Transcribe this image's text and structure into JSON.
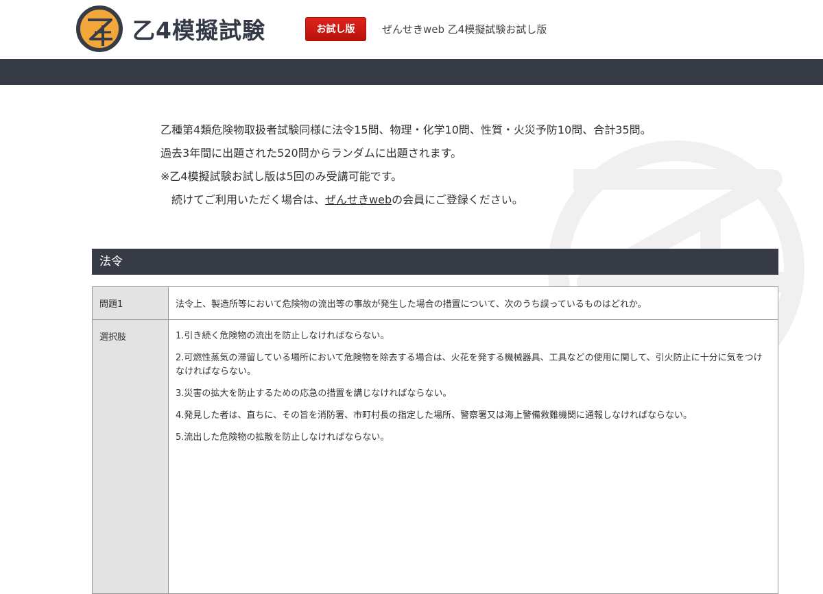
{
  "header": {
    "logo_text": "乙4模擬試験",
    "trial_badge": "お試し版",
    "tagline": "ぜんせきweb 乙4模擬試験お試し版"
  },
  "intro": {
    "line1": "乙種第4類危険物取扱者試験同様に法令15問、物理・化学10問、性質・火災予防10問、合計35問。",
    "line2": "過去3年間に出題された520問からランダムに出題されます。",
    "line3": "※乙4模擬試験お試し版は5回のみ受講可能です。",
    "line4_before": "続けてご利用いただく場合は、",
    "line4_link": "ぜんせきweb",
    "line4_after": "の会員にご登録ください。"
  },
  "section": {
    "title": "法令",
    "question_label": "問題1",
    "question_text": "法令上、製造所等において危険物の流出等の事故が発生した場合の措置について、次のうち誤っているものはどれか。",
    "choices_label": "選択肢",
    "choices": [
      "1.引き続く危険物の流出を防止しなければならない。",
      "2.可燃性蒸気の滞留している場所において危険物を除去する場合は、火花を発する機械器具、工具などの使用に関して、引火防止に十分に気をつけなければならない。",
      "3.災害の拡大を防止するための応急の措置を講じなければならない。",
      "4.発見した者は、直ちに、その旨を消防署、市町村長の指定した場所、警察署又は海上警備救難機関に通報しなければならない。",
      "5.流出した危険物の拡散を防止しなければならない。"
    ]
  },
  "colors": {
    "navbar": "#363b45",
    "logo_ring": "#363b45",
    "logo_fill": "#f3a63a",
    "badge": "#d41a12"
  }
}
